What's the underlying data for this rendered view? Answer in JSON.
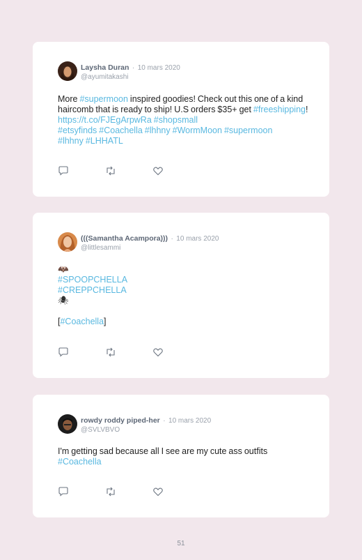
{
  "tweets": [
    {
      "name": "Laysha Duran",
      "sep": "·",
      "date": "10 mars 2020",
      "handle": "@ayumitakashi",
      "segments": [
        {
          "t": "More ",
          "tag": false
        },
        {
          "t": "#supermoon",
          "tag": true
        },
        {
          "t": " inspired goodies! Check out this one of a kind haircomb that is ready to ship! U.S orders $35+ get ",
          "tag": false
        },
        {
          "t": "#freeshipping",
          "tag": true
        },
        {
          "t": "! ",
          "tag": false
        },
        {
          "t": "https://t.co/FJEgArpwRa",
          "tag": true
        },
        {
          "t": " ",
          "tag": false
        },
        {
          "t": "#shopsmall",
          "tag": true
        },
        {
          "t": "\n",
          "tag": false
        },
        {
          "t": "#etsyfinds",
          "tag": true
        },
        {
          "t": " ",
          "tag": false
        },
        {
          "t": "#Coachella",
          "tag": true
        },
        {
          "t": " ",
          "tag": false
        },
        {
          "t": "#lhhny",
          "tag": true
        },
        {
          "t": " ",
          "tag": false
        },
        {
          "t": "#WormMoon",
          "tag": true
        },
        {
          "t": " ",
          "tag": false
        },
        {
          "t": "#supermoon",
          "tag": true
        },
        {
          "t": "\n",
          "tag": false
        },
        {
          "t": "#lhhny",
          "tag": true
        },
        {
          "t": " ",
          "tag": false
        },
        {
          "t": "#LHHATL",
          "tag": true
        }
      ]
    },
    {
      "name": "(((Samantha Acampora)))",
      "sep": "·",
      "date": "10 mars 2020",
      "handle": "@littlesammi",
      "segments": [
        {
          "t": "🦇\n",
          "tag": false
        },
        {
          "t": "#SPOOPCHELLA",
          "tag": true
        },
        {
          "t": "\n",
          "tag": false
        },
        {
          "t": "#CREPPCHELLA",
          "tag": true
        },
        {
          "t": "\n🕷\n\n[",
          "tag": false
        },
        {
          "t": "#Coachella",
          "tag": true
        },
        {
          "t": "]",
          "tag": false
        }
      ]
    },
    {
      "name": "rowdy roddy piped-her",
      "sep": "·",
      "date": "10 mars 2020",
      "handle": "@SVLVBVO",
      "segments": [
        {
          "t": "I'm getting sad because all I see are my cute ass outfits\n",
          "tag": false
        },
        {
          "t": "#Coachella",
          "tag": true
        }
      ]
    }
  ],
  "icons": [
    "reply-icon",
    "retweet-icon",
    "like-icon"
  ],
  "colors": {
    "background": "#f2e7ec",
    "link": "#59b8e0",
    "name": "#5d6776",
    "muted": "#9aa1ab"
  },
  "page_number": "51"
}
